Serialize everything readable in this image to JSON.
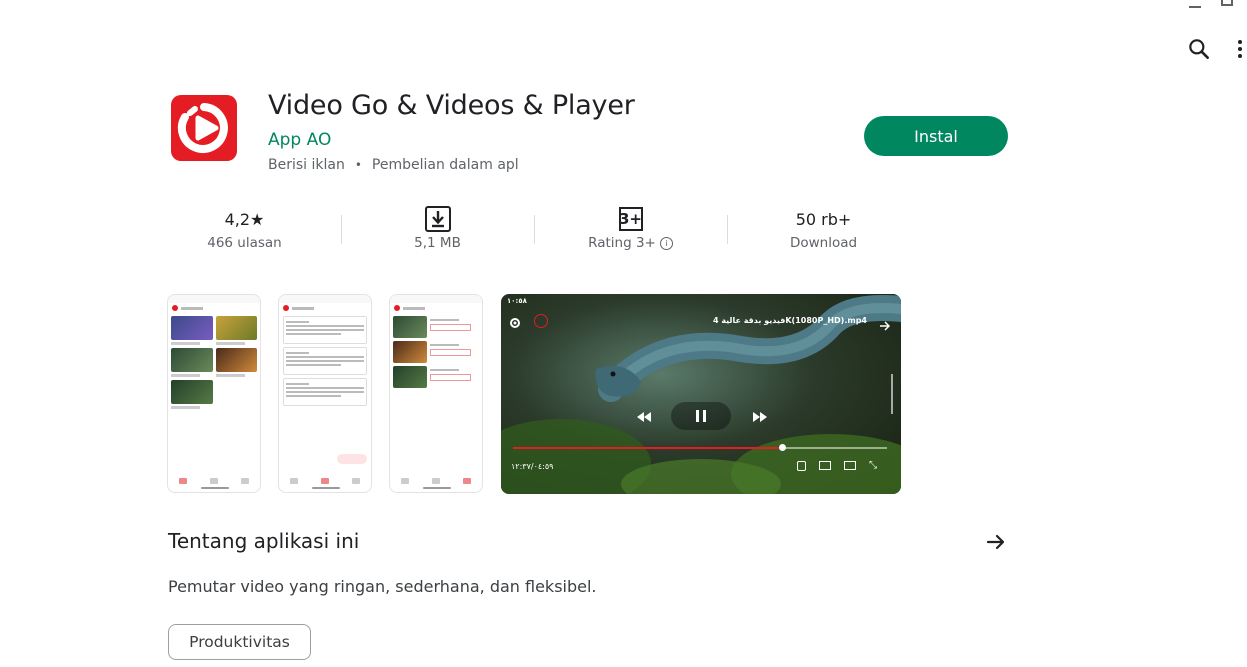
{
  "app": {
    "title": "Video Go & Videos & Player",
    "developer": "App AO",
    "ads_label": "Berisi iklan",
    "separator": "•",
    "iap_label": "Pembelian dalam apl",
    "install_label": "Instal"
  },
  "stats": {
    "rating_value": "4,2★",
    "reviews_label": "466 ulasan",
    "size_label": "5,1 MB",
    "age_badge": "3+",
    "age_label": "Rating 3+",
    "downloads_value": "50 rb+",
    "downloads_label": "Download"
  },
  "video_overlay": {
    "filename": "فيديو بدقة عالية 4K(1080P_HD).mp4",
    "time": "١٢:٣٧/٠٤:٥٩",
    "progress": 0.72
  },
  "about": {
    "title": "Tentang aplikasi ini",
    "description": "Pemutar video yang ringan, sederhana, dan fleksibel.",
    "category_chip": "Produktivitas"
  },
  "colors": {
    "accent": "#01875f",
    "brand_red": "#e41c23"
  },
  "icons": {
    "search": "search-icon",
    "more": "more-vert-icon",
    "download": "download-icon",
    "info": "info-icon",
    "arrow": "arrow-forward-icon"
  }
}
